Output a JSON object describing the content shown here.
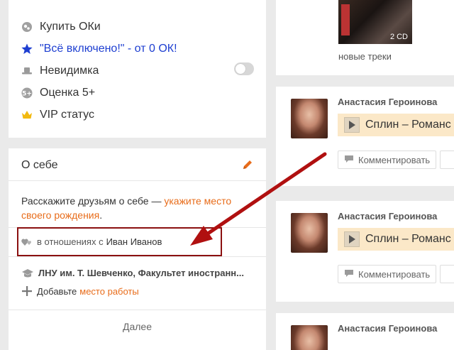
{
  "menu": {
    "items": [
      {
        "label": "Купить ОКи",
        "icon": "coins-icon"
      },
      {
        "label": "\"Всё включено!\" - от 0 ОК!",
        "icon": "star-icon"
      },
      {
        "label": "Невидимка",
        "icon": "hat-icon"
      },
      {
        "label": "Оценка 5+",
        "icon": "five-plus-icon"
      },
      {
        "label": "VIP статус",
        "icon": "crown-icon"
      }
    ],
    "invisible_toggle_on": false
  },
  "about": {
    "title": "О себе",
    "prompt_text": "Расскажите друзьям о себе — ",
    "prompt_link": "укажите место своего рождения",
    "prompt_end": ".",
    "relationship_prefix": "в отношениях с",
    "relationship_name": "Иван Иванов",
    "education": "ЛНУ им. Т. Шевченко, Факультет иностранн...",
    "add_work_prefix": "Добавьте",
    "add_work_link": "место работы",
    "more_label": "Далее"
  },
  "feed": {
    "album_badge": "2 CD",
    "new_tracks_label": "новые треки",
    "posts": [
      {
        "author": "Анастасия Героинова",
        "track": "Сплин – Романс",
        "comment_label": "Комментировать"
      },
      {
        "author": "Анастасия Героинова",
        "track": "Сплин – Романс",
        "comment_label": "Комментировать"
      },
      {
        "author": "Анастасия Героинова"
      }
    ]
  },
  "colors": {
    "link_orange": "#e86c1a",
    "promo_blue": "#1e3fd1",
    "highlight_red": "#8b1010",
    "player_bg": "#fbe8c8"
  }
}
